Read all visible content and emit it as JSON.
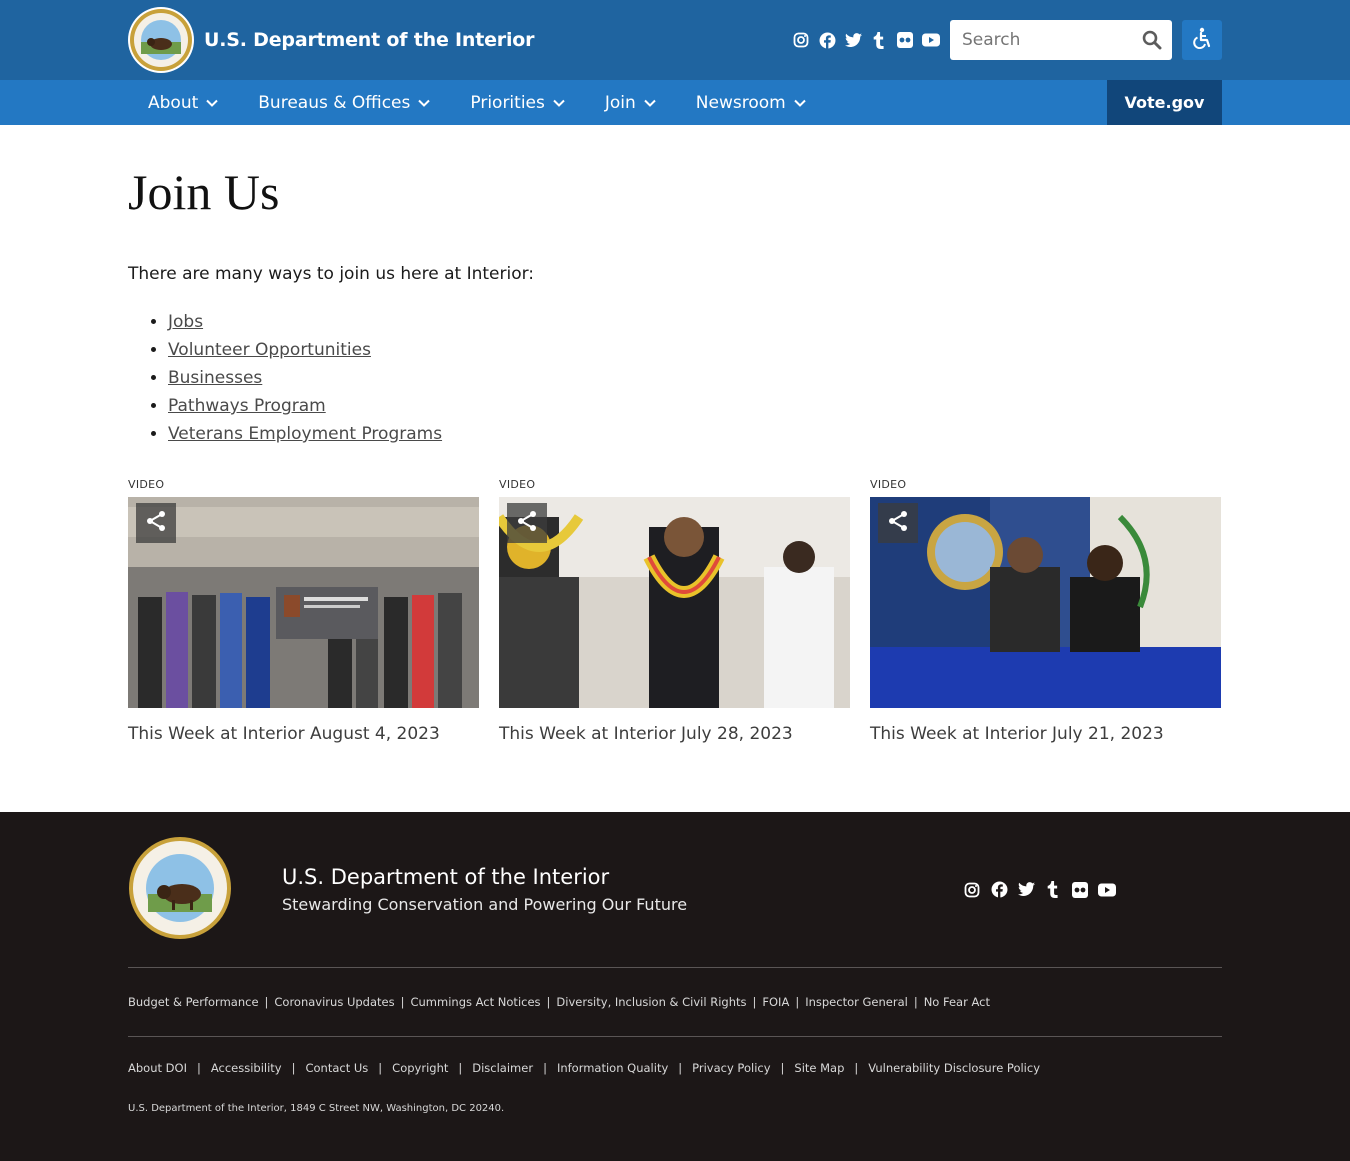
{
  "header": {
    "site_name": "U.S. Department of the Interior",
    "search_placeholder": "Search",
    "social": [
      "instagram-icon",
      "facebook-icon",
      "twitter-icon",
      "tumblr-icon",
      "flickr-icon",
      "youtube-icon"
    ]
  },
  "nav": {
    "items": [
      {
        "label": "About"
      },
      {
        "label": "Bureaus & Offices"
      },
      {
        "label": "Priorities"
      },
      {
        "label": "Join"
      },
      {
        "label": "Newsroom"
      }
    ],
    "vote_label": "Vote.gov"
  },
  "main": {
    "title": "Join Us",
    "intro": "There are many ways to join us here at Interior:",
    "links": [
      {
        "label": "Jobs"
      },
      {
        "label": "Volunteer Opportunities"
      },
      {
        "label": "Businesses"
      },
      {
        "label": "Pathways Program"
      },
      {
        "label": "Veterans Employment Programs"
      }
    ],
    "videos": [
      {
        "tag": "VIDEO",
        "title": "This Week at Interior August 4, 2023"
      },
      {
        "tag": "VIDEO",
        "title": "This Week at Interior July 28, 2023"
      },
      {
        "tag": "VIDEO",
        "title": "This Week at Interior July 21, 2023"
      }
    ]
  },
  "footer": {
    "name": "U.S. Department of the Interior",
    "tagline": "Stewarding Conservation and Powering Our Future",
    "links_row1": [
      "Budget & Performance",
      "Coronavirus Updates",
      "Cummings Act Notices",
      "Diversity, Inclusion & Civil Rights",
      "FOIA",
      "Inspector General",
      "No Fear Act"
    ],
    "links_row2": [
      "About DOI",
      "Accessibility",
      "Contact Us",
      "Copyright",
      "Disclaimer",
      "Information Quality",
      "Privacy Policy",
      "Site Map",
      "Vulnerability Disclosure Policy"
    ],
    "address": "U.S. Department of the Interior, 1849 C Street NW, Washington, DC 20240."
  },
  "colors": {
    "header_bg": "#1f64a0",
    "nav_bg": "#2378c3",
    "vote_bg": "#11467a",
    "footer_bg": "#1c1717"
  }
}
